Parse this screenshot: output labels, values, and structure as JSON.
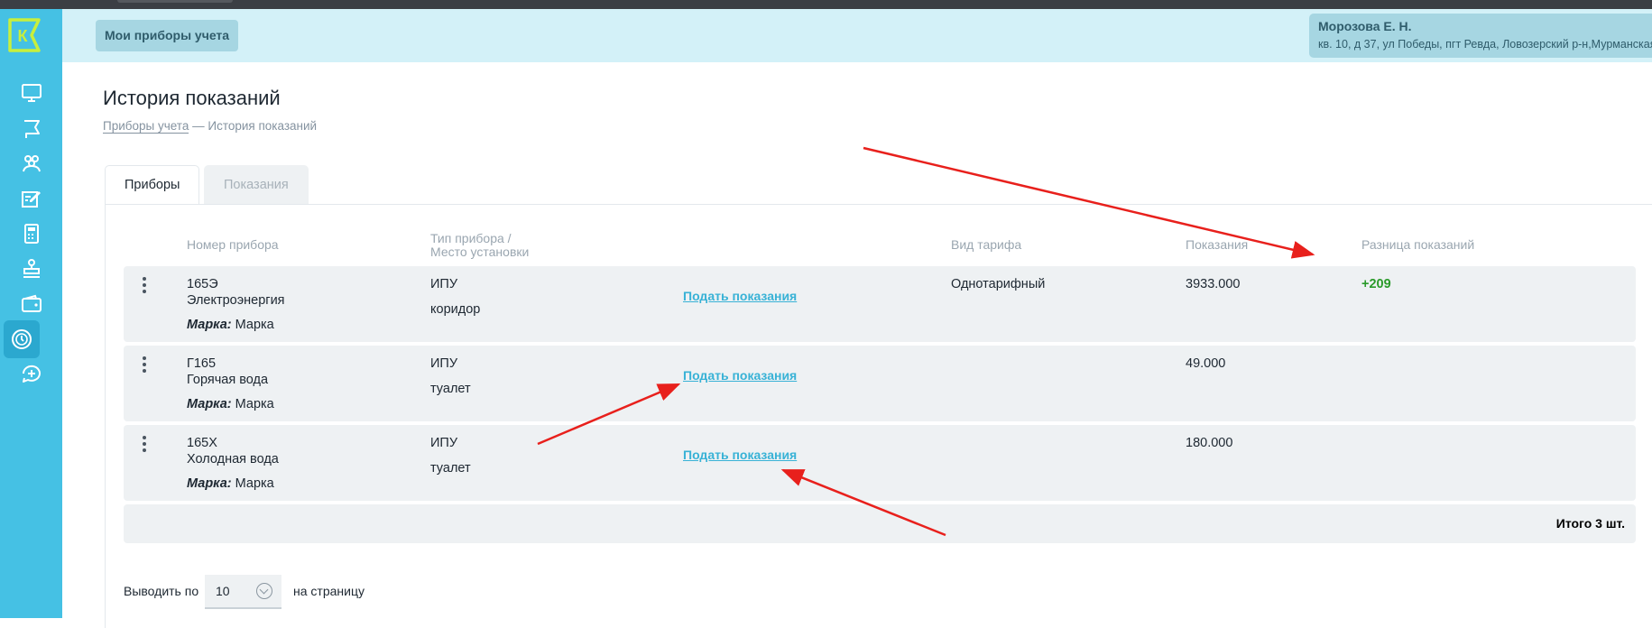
{
  "header": {
    "nav_pill": "Мои приборы учета",
    "user_name": "Морозова Е. Н.",
    "user_address": "кв. 10, д 37, ул Победы, пгт Ревда, Ловозерский р-н,Мурманская"
  },
  "sidebar": {
    "logo": "К",
    "items": [
      "monitor-icon",
      "flag-icon",
      "users-icon",
      "edit-icon",
      "calculator-icon",
      "stamp-icon",
      "wallet-icon",
      "meter-icon",
      "chat-plus-icon"
    ],
    "active_item": "meter-icon"
  },
  "page": {
    "title": "История показаний",
    "breadcrumb_link": "Приборы учета",
    "breadcrumb_current": "— История показаний"
  },
  "tabs": [
    {
      "label": "Приборы",
      "active": true
    },
    {
      "label": "Показания",
      "active": false
    }
  ],
  "table": {
    "columns": {
      "number": "Номер прибора",
      "type_line1": "Тип прибора /",
      "type_line2": "Место установки",
      "tariff": "Вид тарифа",
      "readings": "Показания",
      "diff": "Разница показаний"
    },
    "rows": [
      {
        "number": "165Э",
        "resource": "Электроэнергия",
        "brand_label": "Марка:",
        "brand": "Марка",
        "type": "ИПУ",
        "location": "коридор",
        "action": "Подать показания",
        "tariff": "Однотарифный",
        "reading": "3933.000",
        "diff": "+209"
      },
      {
        "number": "Г165",
        "resource": "Горячая вода",
        "brand_label": "Марка:",
        "brand": "Марка",
        "type": "ИПУ",
        "location": "туалет",
        "action": "Подать показания",
        "tariff": "",
        "reading": "49.000",
        "diff": ""
      },
      {
        "number": "165Х",
        "resource": "Холодная вода",
        "brand_label": "Марка:",
        "brand": "Марка",
        "type": "ИПУ",
        "location": "туалет",
        "action": "Подать показания",
        "tariff": "",
        "reading": "180.000",
        "diff": ""
      }
    ],
    "total": "Итого 3 шт."
  },
  "pagination": {
    "prefix": "Выводить по",
    "value": "10",
    "suffix": "на страницу"
  },
  "colors": {
    "sidebar": "#45c1e4",
    "header": "#d3f1f8",
    "link": "#38b2d6",
    "positive": "#2a9a2a",
    "annotation_arrow": "#e8201c"
  }
}
